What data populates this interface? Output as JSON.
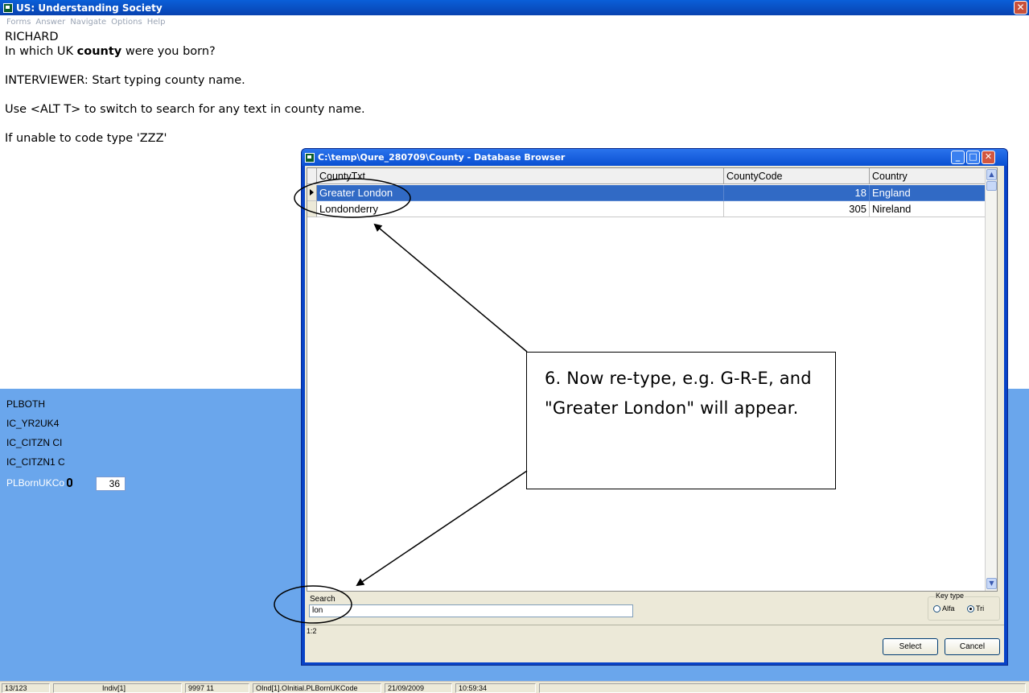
{
  "window": {
    "title": "US: Understanding Society",
    "close_glyph": "✕"
  },
  "menu": [
    "Forms",
    "Answer",
    "Navigate",
    "Options",
    "Help"
  ],
  "question": {
    "name": "RICHARD",
    "text_before": "In which UK ",
    "text_bold": "county",
    "text_after": " were you born?",
    "instruction1": "INTERVIEWER: Start typing county name.",
    "instruction2": "Use <ALT T> to switch to search for any text in county name.",
    "instruction3": "If unable to code type 'ZZZ'"
  },
  "fields": [
    "PLBOTH",
    "IC_YR2UK4",
    "IC_CITZN CI",
    "IC_CITZN1 C",
    "PLBornUKCo"
  ],
  "answer_value": "36",
  "dialog": {
    "title": "C:\\temp\\Qure_280709\\County - Database Browser",
    "columns": [
      "CountyTxt",
      "CountyCode",
      "Country"
    ],
    "rows": [
      {
        "county": "Greater London",
        "code": "18",
        "country": "England",
        "selected": true
      },
      {
        "county": "Londonderry",
        "code": "305",
        "country": "Nireland",
        "selected": false
      }
    ],
    "search_label": "Search",
    "search_value": "lon",
    "key_type_label": "Key type",
    "key_type_options": [
      "Alfa",
      "Tri"
    ],
    "key_type_selected": "Tri",
    "count": "1:2",
    "select_button": "Select",
    "cancel_button": "Cancel"
  },
  "callout_text": "6. Now re-type, e.g. G-R-E, and \"Greater London\" will appear.",
  "status_bar": [
    "13/123",
    "",
    "Indiv[1]",
    "9997 11",
    "OInd[1].OInitial.PLBornUKCode",
    "21/09/2009",
    "10:59:34"
  ]
}
